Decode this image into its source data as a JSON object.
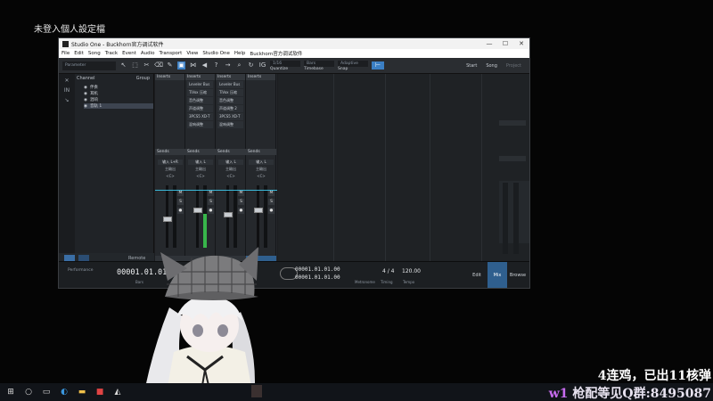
{
  "overlay": {
    "top_label": "未登入個人設定檔",
    "line1": "4连鸡，已出11核弹",
    "line2_prefix": "w1",
    "line2_middle": " 枪配等见Q群:",
    "line2_number": "8495087"
  },
  "window": {
    "title": "Studio One - Buckhorn官方调试软件",
    "controls": [
      "—",
      "☐",
      "✕"
    ]
  },
  "menu": [
    "File",
    "Edit",
    "Song",
    "Track",
    "Event",
    "Audio",
    "Transport",
    "View",
    "Studio One",
    "Help",
    "Buckhorn官方调试软件"
  ],
  "toolbar": {
    "preset_placeholder": "Parameter",
    "quantize": "1/16",
    "quantize_label": "Quantize",
    "timebase": "Bars",
    "timebase_label": "Timebase",
    "snap": "Adaptive",
    "snap_label": "Snap",
    "start": "Start",
    "song": "Song",
    "project": "Project"
  },
  "tracklist": {
    "header_channel": "Channel",
    "header_group": "Group",
    "rows": [
      "伴奏",
      "耳机",
      "混响",
      "音轨 1"
    ],
    "footer_remote": "Remote",
    "icons": [
      "close-x",
      "in",
      "out"
    ]
  },
  "mixer": {
    "strips": [
      {
        "inserts_label": "Inserts",
        "fx": [
          "",
          "",
          "",
          "",
          ""
        ],
        "sends_label": "Sends",
        "name": "输入 L+R",
        "sub": "主輸出",
        "pan": "<C>",
        "footer": ""
      },
      {
        "inserts_label": "Inserts",
        "fx": [
          "Leveler Bus",
          "TiVox 压缩",
          "音色调整",
          "声道调整",
          "3PCS5 XD-T",
          "混响调整"
        ],
        "sends_label": "Sends",
        "name": "输入 L",
        "sub": "主輸出",
        "pan": "<C>",
        "footer": ""
      },
      {
        "inserts_label": "Inserts",
        "fx": [
          "Leveler Bus",
          "TiVox 压缩",
          "音色调整",
          "声道调整 2",
          "3PCS5 XD-T",
          "混响调整"
        ],
        "sends_label": "Sends",
        "name": "输入 L",
        "sub": "主輸出",
        "pan": "<C>",
        "footer": ""
      },
      {
        "inserts_label": "Inserts",
        "fx": [
          "",
          "",
          "",
          "",
          ""
        ],
        "sends_label": "Sends",
        "name": "输入 L",
        "sub": "主輸出",
        "pan": "<C>",
        "footer": ""
      }
    ],
    "buttons": [
      "M",
      "S",
      "●"
    ]
  },
  "transport": {
    "performance_label": "Performance",
    "time": "00001.01.01.00",
    "bars_label": "Bars",
    "loop_start": "00001.01.01.00",
    "loop_end": "00001.01.01.00",
    "metronome_label": "Metronome",
    "timesig": "4 / 4",
    "timing_label": "Timing",
    "tempo": "120.00",
    "tempo_label": "Tempo",
    "edit": "Edit",
    "mix": "Mix",
    "browse": "Browse"
  },
  "taskbar": {
    "icons": [
      "windows-icon",
      "search-icon",
      "taskview-icon",
      "edge-icon",
      "explorer-icon",
      "app-icon",
      "studioone-icon"
    ]
  },
  "colors": {
    "accent": "#3b7fc4",
    "meter": "#38b54a",
    "cyan": "#3ab7d8",
    "purple": "#c86cf0"
  }
}
